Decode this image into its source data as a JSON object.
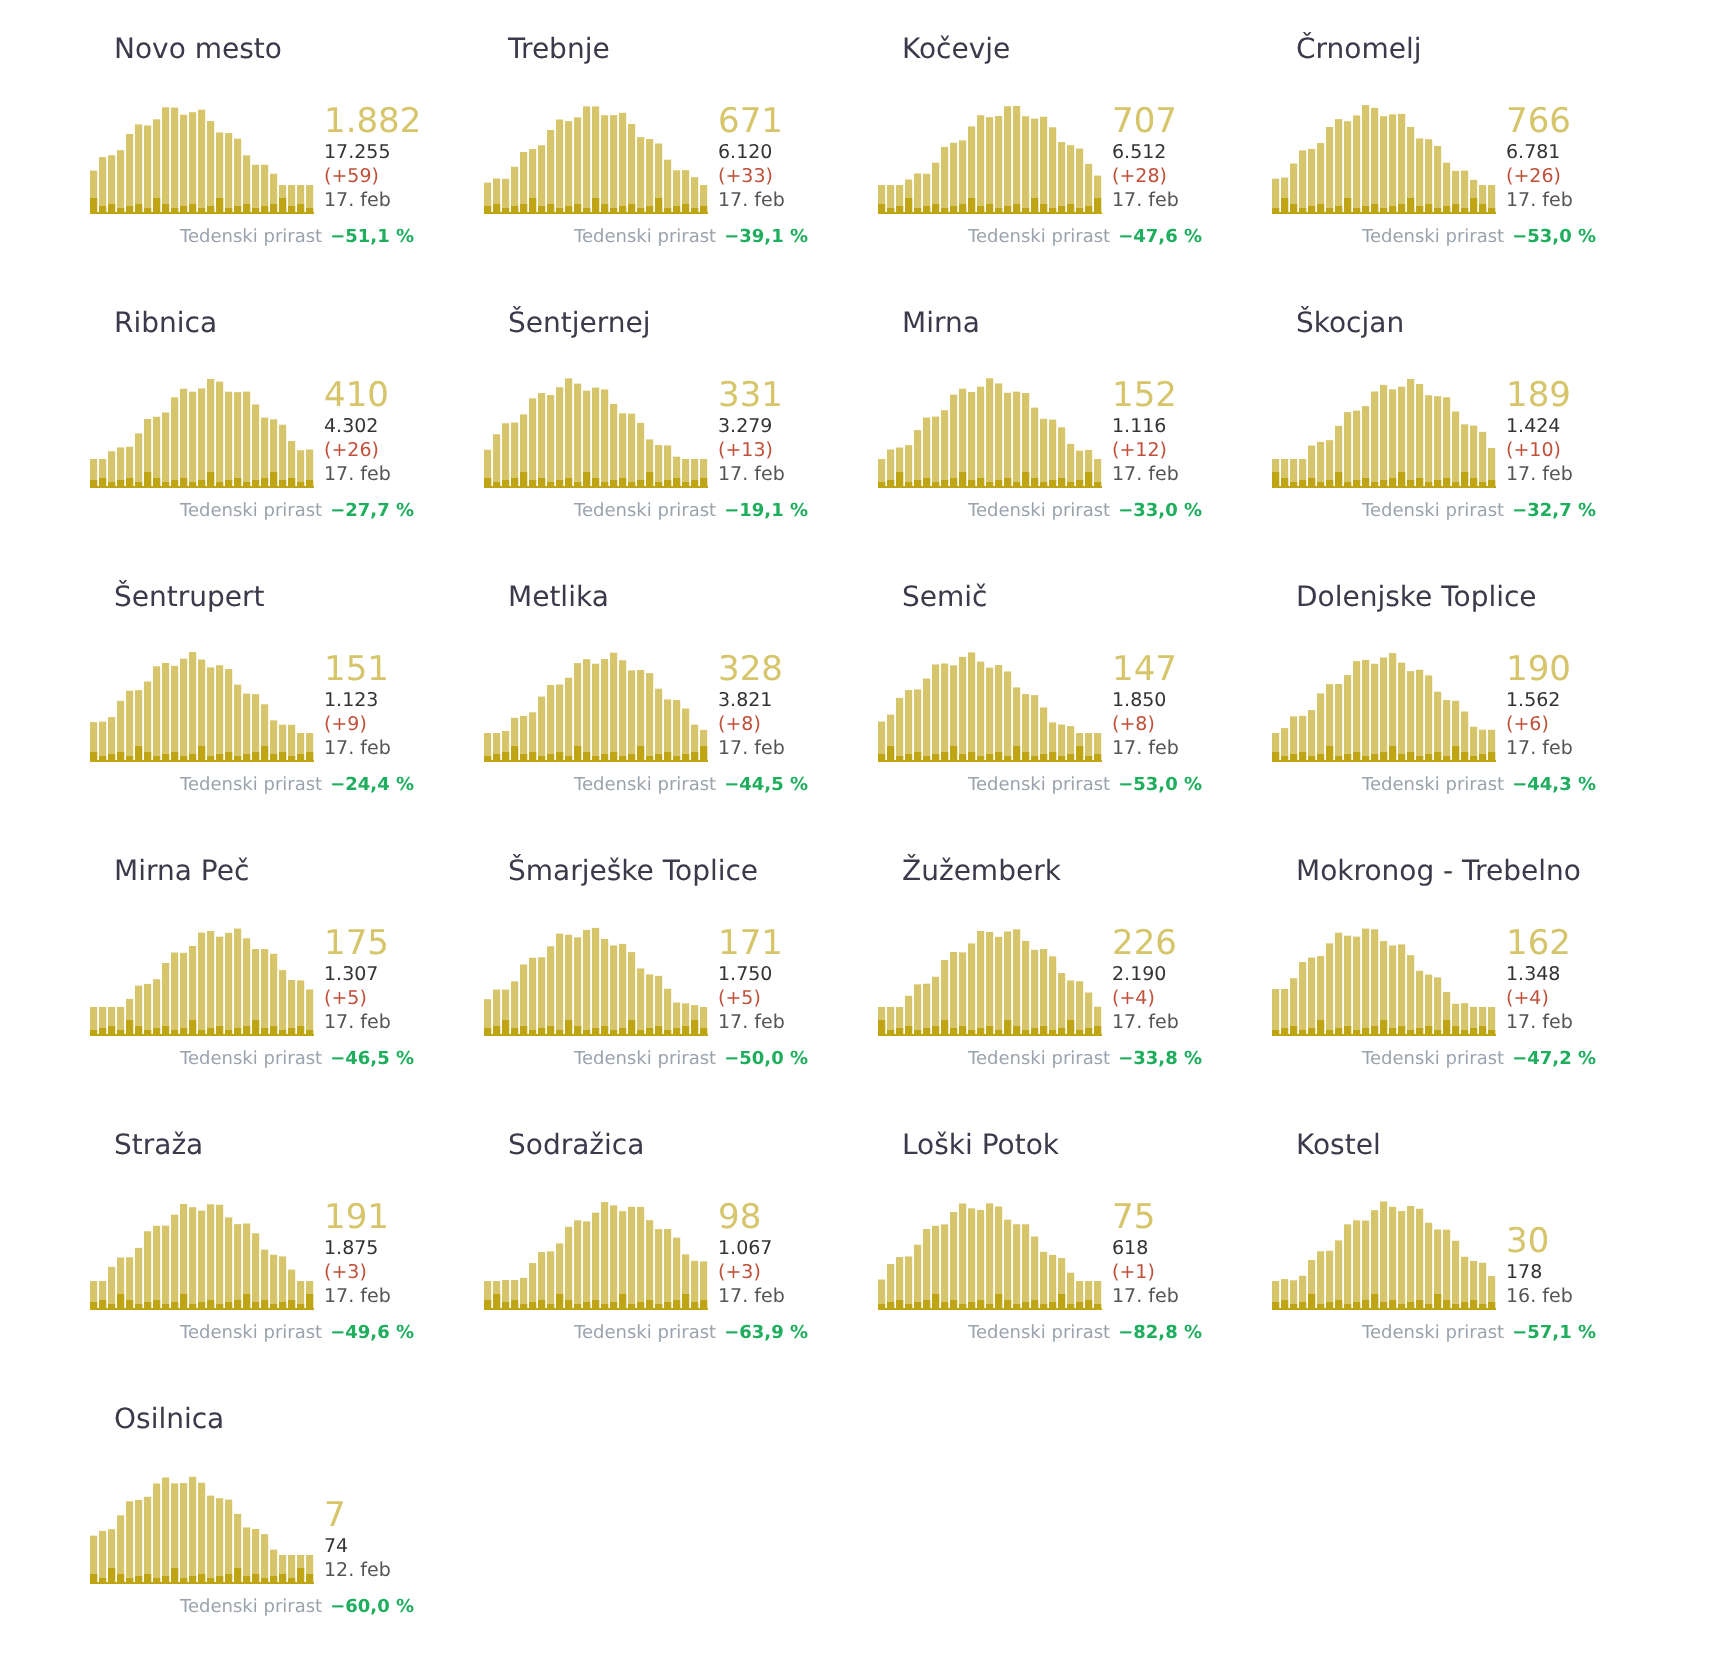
{
  "cards": [
    {
      "name": "Novo mesto",
      "active": "1.882",
      "total": "17.255",
      "new": "(+59)",
      "date": "17. feb",
      "growth_label": "Tedenski prirast",
      "growth": "−51,1 %"
    },
    {
      "name": "Trebnje",
      "active": "671",
      "total": "6.120",
      "new": "(+33)",
      "date": "17. feb",
      "growth_label": "Tedenski prirast",
      "growth": "−39,1 %"
    },
    {
      "name": "Kočevje",
      "active": "707",
      "total": "6.512",
      "new": "(+28)",
      "date": "17. feb",
      "growth_label": "Tedenski prirast",
      "growth": "−47,6 %"
    },
    {
      "name": "Črnomelj",
      "active": "766",
      "total": "6.781",
      "new": "(+26)",
      "date": "17. feb",
      "growth_label": "Tedenski prirast",
      "growth": "−53,0 %"
    },
    {
      "name": "Ribnica",
      "active": "410",
      "total": "4.302",
      "new": "(+26)",
      "date": "17. feb",
      "growth_label": "Tedenski prirast",
      "growth": "−27,7 %"
    },
    {
      "name": "Šentjernej",
      "active": "331",
      "total": "3.279",
      "new": "(+13)",
      "date": "17. feb",
      "growth_label": "Tedenski prirast",
      "growth": "−19,1 %"
    },
    {
      "name": "Mirna",
      "active": "152",
      "total": "1.116",
      "new": "(+12)",
      "date": "17. feb",
      "growth_label": "Tedenski prirast",
      "growth": "−33,0 %"
    },
    {
      "name": "Škocjan",
      "active": "189",
      "total": "1.424",
      "new": "(+10)",
      "date": "17. feb",
      "growth_label": "Tedenski prirast",
      "growth": "−32,7 %"
    },
    {
      "name": "Šentrupert",
      "active": "151",
      "total": "1.123",
      "new": "(+9)",
      "date": "17. feb",
      "growth_label": "Tedenski prirast",
      "growth": "−24,4 %"
    },
    {
      "name": "Metlika",
      "active": "328",
      "total": "3.821",
      "new": "(+8)",
      "date": "17. feb",
      "growth_label": "Tedenski prirast",
      "growth": "−44,5 %"
    },
    {
      "name": "Semič",
      "active": "147",
      "total": "1.850",
      "new": "(+8)",
      "date": "17. feb",
      "growth_label": "Tedenski prirast",
      "growth": "−53,0 %"
    },
    {
      "name": "Dolenjske Toplice",
      "active": "190",
      "total": "1.562",
      "new": "(+6)",
      "date": "17. feb",
      "growth_label": "Tedenski prirast",
      "growth": "−44,3 %"
    },
    {
      "name": "Mirna Peč",
      "active": "175",
      "total": "1.307",
      "new": "(+5)",
      "date": "17. feb",
      "growth_label": "Tedenski prirast",
      "growth": "−46,5 %"
    },
    {
      "name": "Šmarješke Toplice",
      "active": "171",
      "total": "1.750",
      "new": "(+5)",
      "date": "17. feb",
      "growth_label": "Tedenski prirast",
      "growth": "−50,0 %"
    },
    {
      "name": "Žužemberk",
      "active": "226",
      "total": "2.190",
      "new": "(+4)",
      "date": "17. feb",
      "growth_label": "Tedenski prirast",
      "growth": "−33,8 %"
    },
    {
      "name": "Mokronog - Trebelno",
      "active": "162",
      "total": "1.348",
      "new": "(+4)",
      "date": "17. feb",
      "growth_label": "Tedenski prirast",
      "growth": "−47,2 %"
    },
    {
      "name": "Straža",
      "active": "191",
      "total": "1.875",
      "new": "(+3)",
      "date": "17. feb",
      "growth_label": "Tedenski prirast",
      "growth": "−49,6 %"
    },
    {
      "name": "Sodražica",
      "active": "98",
      "total": "1.067",
      "new": "(+3)",
      "date": "17. feb",
      "growth_label": "Tedenski prirast",
      "growth": "−63,9 %"
    },
    {
      "name": "Loški Potok",
      "active": "75",
      "total": "618",
      "new": "(+1)",
      "date": "17. feb",
      "growth_label": "Tedenski prirast",
      "growth": "−82,8 %"
    },
    {
      "name": "Kostel",
      "active": "30",
      "total": "178",
      "date": "16. feb",
      "growth_label": "Tedenski prirast",
      "growth": "−57,1 %"
    },
    {
      "name": "Osilnica",
      "active": "7",
      "total": "74",
      "date": "12. feb",
      "growth_label": "Tedenski prirast",
      "growth": "−60,0 %"
    }
  ]
}
